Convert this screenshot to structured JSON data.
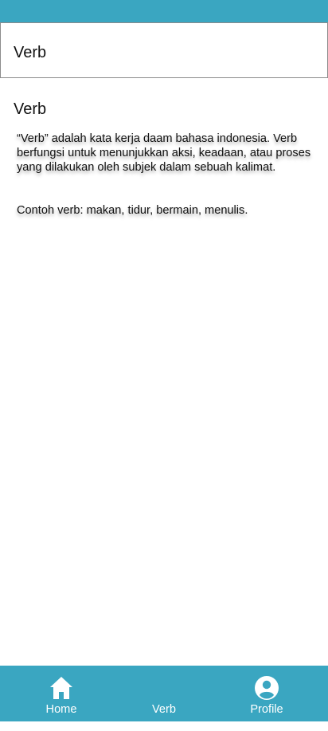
{
  "app": {
    "header_title": "Verb"
  },
  "content": {
    "title": "Verb",
    "paragraph_1": "“Verb” adalah kata kerja daam bahasa indonesia. Verb berfungsi untuk menunjukkan aksi, keadaan, atau proses yang dilakukan oleh subjek dalam sebuah kalimat.",
    "paragraph_2": "Contoh verb: makan, tidur, bermain, menulis."
  },
  "bottom_nav": {
    "items": [
      {
        "label": "Home",
        "icon": "home-icon"
      },
      {
        "label": "Verb",
        "icon": ""
      },
      {
        "label": "Profile",
        "icon": "profile-icon"
      }
    ]
  },
  "colors": {
    "accent": "#3aa6c1",
    "background": "#ffffff",
    "text": "#111111"
  }
}
